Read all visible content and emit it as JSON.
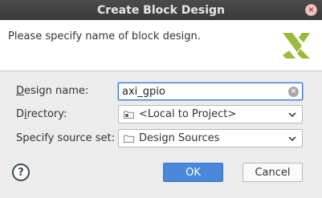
{
  "window": {
    "title": "Create Block Design"
  },
  "header": {
    "message": "Please specify name of block design."
  },
  "form": {
    "design_name": {
      "label_mnemonic": "D",
      "label_rest": "esign name:",
      "value": "axi_gpio"
    },
    "directory": {
      "label_mnemonic": "i",
      "label_pre": "D",
      "label_rest": "rectory:",
      "value": "<Local to Project>"
    },
    "source_set": {
      "label": "Specify source set:",
      "value": "Design Sources"
    }
  },
  "buttons": {
    "help": "?",
    "ok": "OK",
    "cancel": "Cancel"
  },
  "colors": {
    "accent": "#4a89da",
    "logo": "#9bb93a",
    "titlebar": "#3f3f3f"
  }
}
